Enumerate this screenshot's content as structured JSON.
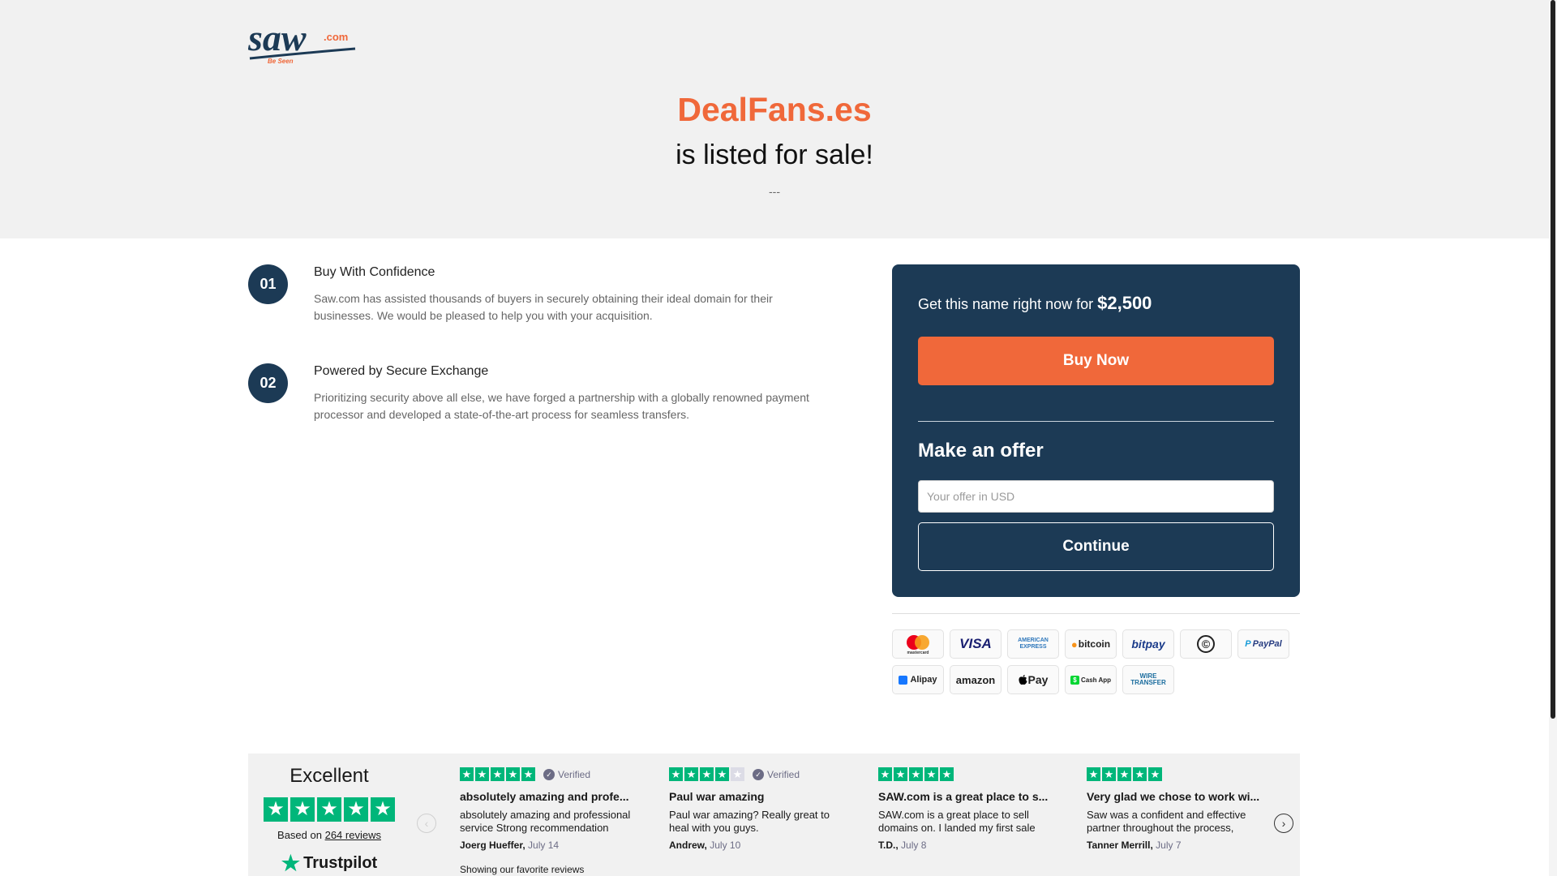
{
  "brand": {
    "logo_text": "saw.com",
    "logo_tag": "Be Seen",
    "accent": "#f0683a",
    "navy": "#1c3a55"
  },
  "hero": {
    "domain": "DealFans.es",
    "subtitle": "is listed for sale!",
    "separator": "---"
  },
  "features": [
    {
      "number": "01",
      "title": "Buy With Confidence",
      "description": "Saw.com has assisted thousands of buyers in securely obtaining their ideal domain for their businesses. We would be pleased to help you with your acquisition."
    },
    {
      "number": "02",
      "title": "Powered by Secure Exchange",
      "description": "Prioritizing security above all else, we have forged a partnership with a globally renowned payment processor and developed a state-of-the-art process for seamless transfers."
    }
  ],
  "purchase": {
    "price_prefix": "Get this name right now for",
    "price": "$2,500",
    "buy_label": "Buy Now",
    "offer_title": "Make an offer",
    "offer_placeholder": "Your offer in USD",
    "continue_label": "Continue"
  },
  "payment_methods": [
    "mastercard",
    "VISA",
    "AMERICAN EXPRESS",
    "bitcoin",
    "bitpay",
    "©",
    "PayPal",
    "Alipay",
    "amazon",
    "Pay",
    "Cash App",
    "WIRE TRANSFER"
  ],
  "reviews": {
    "rating_word": "Excellent",
    "based_on_prefix": "Based on",
    "based_on_link": "264 reviews",
    "trustpilot": "Trustpilot",
    "footer_note": "Showing our favorite reviews",
    "star_color": "#00b67a",
    "items": [
      {
        "stars": 5,
        "verified": "Verified",
        "title": "absolutely amazing and profe...",
        "body": "absolutely amazing and professional service Strong recommendation",
        "author": "Joerg Hueffer,",
        "date": "July 14"
      },
      {
        "stars": 4,
        "verified": "Verified",
        "title": "Paul war amazing",
        "body": "Paul war amazing? Really great to heal with you guys.",
        "author": "Andrew,",
        "date": "July 10"
      },
      {
        "stars": 5,
        "verified": "",
        "title": "SAW.com is a great place to s...",
        "body": "SAW.com is a great place to sell domains on. I landed my first sale",
        "author": "T.D.,",
        "date": "July 8"
      },
      {
        "stars": 5,
        "verified": "",
        "title": "Very glad we chose to work wi...",
        "body": "Saw was a confident and effective partner throughout the process,",
        "author": "Tanner Merrill,",
        "date": "July 7"
      }
    ]
  }
}
